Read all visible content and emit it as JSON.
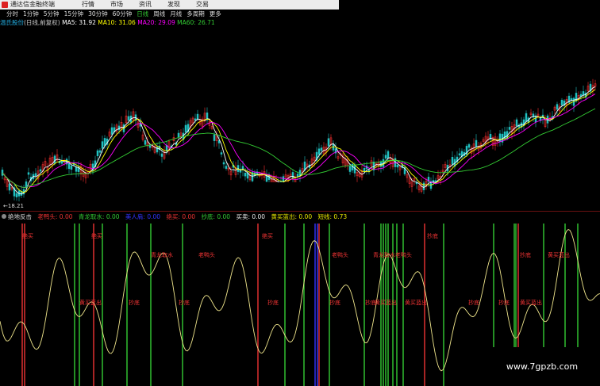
{
  "app": {
    "title": "通达信金融终端"
  },
  "menu": [
    "行情",
    "市场",
    "资讯",
    "发现",
    "交易"
  ],
  "periods": {
    "items": [
      "分时",
      "1分钟",
      "5分钟",
      "15分钟",
      "30分钟",
      "60分钟",
      "日线",
      "周线",
      "月线",
      "多周期",
      "更多"
    ],
    "active": "日线"
  },
  "stock": {
    "name": "温氏股份",
    "mode": "(日线,前复权)",
    "ma5": "MA5: 31.92",
    "ma10": "MA10: 31.06",
    "ma20": "MA20: 29.09",
    "ma60": "MA60: 26.71",
    "low_label": "←18.21"
  },
  "indicator": {
    "name": "绝地反击",
    "items": [
      "老鸭头: 0.00",
      "青龙取水: 0.00",
      "美人肩: 0.00",
      "绝买: 0.00",
      "抄底: 0.00",
      "买卖: 0.00",
      "黄买蓝出: 0.00",
      "短线: 0.73"
    ],
    "signal_labels": [
      "绝买",
      "绝买",
      "青龙取水",
      "老鸭头",
      "绝买",
      "老鸭头",
      "青龙取水",
      "老鸭头",
      "黄买蓝出",
      "抄底",
      "抄底",
      "抄底",
      "抄底",
      "抄底",
      "抄底",
      "抄底",
      "黄买蓝出",
      "黄买蓝出",
      "黄买蓝出",
      "抄底",
      "抄底",
      "黄买蓝出"
    ]
  },
  "watermark": "www.7gpzb.com",
  "colors": {
    "up": "#ff3030",
    "down": "#20c0c0",
    "ma5": "#ffffff",
    "ma10": "#ffff00",
    "ma20": "#ff00ff",
    "ma60": "#33cc33",
    "osc": "#f0e68c"
  }
}
